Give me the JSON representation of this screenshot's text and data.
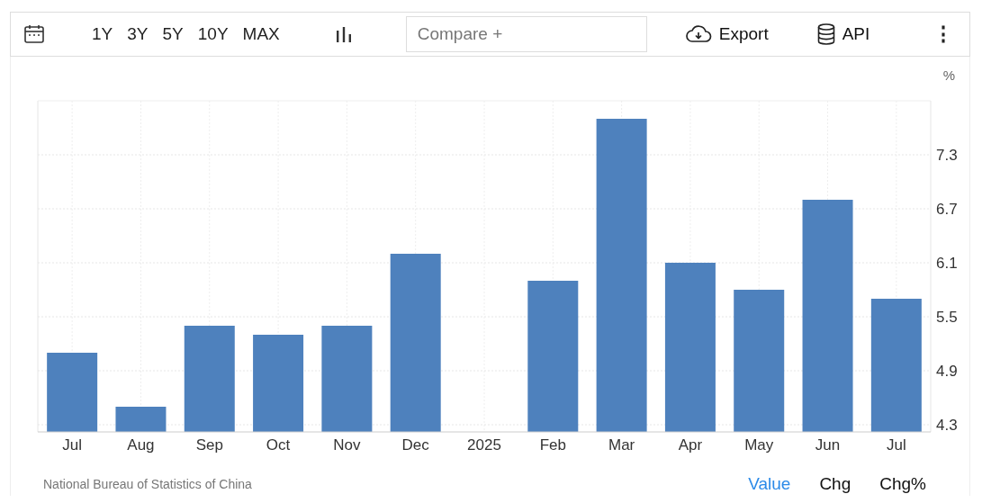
{
  "toolbar": {
    "ranges": [
      {
        "label": "1Y",
        "selected": false
      },
      {
        "label": "3Y",
        "selected": false
      },
      {
        "label": "5Y",
        "selected": false
      },
      {
        "label": "10Y",
        "selected": false
      },
      {
        "label": "MAX",
        "selected": false
      }
    ],
    "compare": {
      "placeholder": "Compare +"
    },
    "export": "Export",
    "api": "API",
    "more": "⋮"
  },
  "unit": "%",
  "chart": {
    "chart_data": {
      "type": "bar",
      "categories": [
        "Jul",
        "Aug",
        "Sep",
        "Oct",
        "Nov",
        "Dec",
        "2025",
        "Feb",
        "Mar",
        "Apr",
        "May",
        "Jun",
        "Jul"
      ],
      "grid": true,
      "series": [
        {
          "color": "#4e81bd",
          "values": [
            5.1,
            4.5,
            5.4,
            5.3,
            5.4,
            6.2,
            null,
            5.9,
            7.7,
            6.1,
            5.8,
            6.8,
            5.7
          ]
        }
      ],
      "ylim": [
        4.22,
        7.9
      ],
      "yticks": [
        4.3,
        4.9,
        5.5,
        6.1,
        6.7,
        7.3
      ]
    }
  },
  "footer": {
    "source": "National Bureau of Statistics of China",
    "views": [
      {
        "label": "Value",
        "selected": true
      },
      {
        "label": "Chg",
        "selected": false
      },
      {
        "label": "Chg%",
        "selected": false
      }
    ]
  }
}
